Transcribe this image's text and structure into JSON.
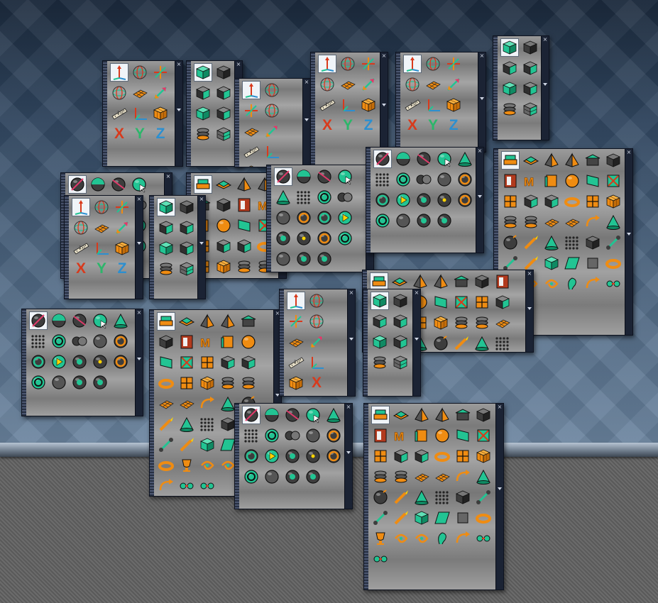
{
  "scene": {
    "sky_color": "#5d7591",
    "ground_color": "#616161"
  },
  "colors": {
    "accent_green": "#22c493",
    "accent_orange": "#ef8c12",
    "dark_gray": "#3d3d3d",
    "axis_x": "#d83a1c",
    "axis_y": "#2cb66a",
    "axis_z": "#2c8fd0",
    "arrow_pink": "#e13a6a"
  },
  "palettes": {
    "transform": [
      "move-widget-icon",
      "rotate-widget-icon",
      "move-xyz-icon",
      "rotate-axes-icon",
      "grid-snap-icon",
      "scale-arrows-icon",
      "ruler-icon",
      "corner-axes-icon",
      "cube-grid-icon",
      "x-axis-icon",
      "y-axis-icon",
      "z-axis-icon"
    ],
    "select": [
      "cube-select-icon",
      "cube-face-icon",
      "cube-edge-icon",
      "cube-corner-icon",
      "cube-green-icon",
      "cube-wedge-icon",
      "stack-rings-icon",
      "grid-cube-icon"
    ],
    "sphere": [
      "sphere-move-icon",
      "sphere-half-icon",
      "sphere-cut-icon",
      "sphere-pointer-icon",
      "cone-icon",
      "dot-cloud-icon",
      "ring-sphere-icon",
      "sphere-pair-icon",
      "sphere-gray-icon",
      "ring-orange-icon",
      "ring-cut-icon",
      "sphere-play-icon",
      "sphere-target-icon",
      "sphere-dot-icon",
      "sphere-orange-icon",
      "sphere-ring-icon",
      "sphere-dark-icon",
      "sphere-swirl-icon",
      "sphere-split-icon"
    ],
    "modeling": [
      "box-stack-icon",
      "slab-icon",
      "pyramid-icon",
      "prism-icon",
      "cap-icon",
      "cube-dark-icon",
      "door-icon",
      "letter-m-icon",
      "book-icon",
      "ball-orange-icon",
      "face-green-icon",
      "face-cross-icon",
      "face-split-icon",
      "wedge-icon",
      "cube-cut-icon",
      "torus-cut-icon",
      "frame-icon",
      "grid-cube-green-icon",
      "cylinder-stack-icon",
      "rings-stack-icon",
      "panel-split-icon",
      "mesh-grid-icon",
      "bend-arrow-icon",
      "pencil-cone-icon",
      "bomb-icon",
      "pencil-pen-icon",
      "cone-black-icon",
      "star-grid-icon",
      "cube-black-icon",
      "bone-icon",
      "pipe-icon",
      "wand-icon",
      "check-face-icon",
      "shear-face-icon",
      "empty-slot-icon",
      "torus-icon",
      "cup-icon",
      "swirl-icon",
      "swirl-arrows-icon",
      "ear-icon",
      "hook-arrow-icon",
      "node-link-icon",
      "node-cross-icon"
    ]
  },
  "panels": [
    {
      "id": "p01",
      "kind": "transform",
      "side_gap": 0
    },
    {
      "id": "p02",
      "kind": "select",
      "side_gap": 0
    },
    {
      "id": "p03",
      "kind": "transform",
      "side_gap": 0
    },
    {
      "id": "p04",
      "kind": "transform",
      "side_gap": 0
    },
    {
      "id": "p05",
      "kind": "transform",
      "side_gap": 0
    },
    {
      "id": "p06",
      "kind": "select",
      "side_gap": 0
    },
    {
      "id": "p07",
      "kind": "sphere",
      "side_gap": 0
    },
    {
      "id": "p08",
      "kind": "modeling",
      "side_gap": 0
    },
    {
      "id": "p09",
      "kind": "transform",
      "side_gap": 0
    },
    {
      "id": "p10",
      "kind": "select",
      "side_gap": 0
    },
    {
      "id": "p11",
      "kind": "sphere",
      "side_gap": 0
    },
    {
      "id": "p12",
      "kind": "sphere",
      "side_gap": 0
    },
    {
      "id": "p13",
      "kind": "modeling",
      "side_gap": 0
    },
    {
      "id": "p14",
      "kind": "modeling",
      "side_gap": 0
    },
    {
      "id": "p15",
      "kind": "sphere",
      "side_gap": 0
    },
    {
      "id": "p16",
      "kind": "modeling",
      "side_gap": 0
    },
    {
      "id": "p17",
      "kind": "transform",
      "side_gap": 0
    },
    {
      "id": "p18",
      "kind": "select",
      "side_gap": 0
    },
    {
      "id": "p19",
      "kind": "sphere",
      "side_gap": 0
    },
    {
      "id": "p20",
      "kind": "modeling",
      "side_gap": 0
    }
  ],
  "labels": {
    "axis_x": "X",
    "axis_y": "Y",
    "axis_z": "Z",
    "close": "×"
  }
}
